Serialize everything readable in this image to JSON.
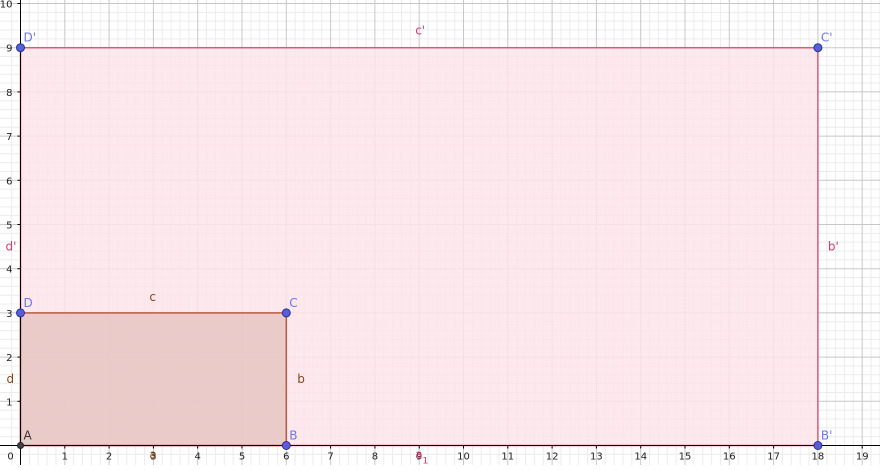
{
  "x_ticks": [
    "0",
    "1",
    "2",
    "3",
    "4",
    "5",
    "6",
    "7",
    "8",
    "9",
    "10",
    "11",
    "12",
    "13",
    "14",
    "15",
    "16",
    "17",
    "18",
    "19"
  ],
  "y_ticks": [
    "1",
    "2",
    "3",
    "4",
    "5",
    "6",
    "7",
    "8",
    "9",
    "10"
  ],
  "colors": {
    "small_fill": "#e8c8c4",
    "small_edge": "#b85a42",
    "large_fill": "#fde4ea",
    "large_edge": "#e0567a",
    "point_fill": "#5560d8",
    "point_edge": "#2a2f9a",
    "point_label": "#6f78e8",
    "origin": "#444444",
    "segment_label_small": "#8a4420",
    "segment_label_large": "#d43d6c"
  },
  "small_rect": {
    "vertices": [
      {
        "name": "A",
        "x": 0,
        "y": 0
      },
      {
        "name": "B",
        "x": 6,
        "y": 0
      },
      {
        "name": "C",
        "x": 6,
        "y": 3
      },
      {
        "name": "D",
        "x": 0,
        "y": 3
      }
    ],
    "sides": {
      "bottom": "a",
      "right": "b",
      "top": "c",
      "left": "d"
    }
  },
  "large_rect": {
    "vertices": [
      {
        "name": "B'",
        "x": 18,
        "y": 0
      },
      {
        "name": "C'",
        "x": 18,
        "y": 9
      },
      {
        "name": "D'",
        "x": 0,
        "y": 9
      }
    ],
    "sides": {
      "bottom_base": "a",
      "bottom_sub": "1",
      "right": "b'",
      "top": "c'",
      "left": "d'"
    }
  }
}
